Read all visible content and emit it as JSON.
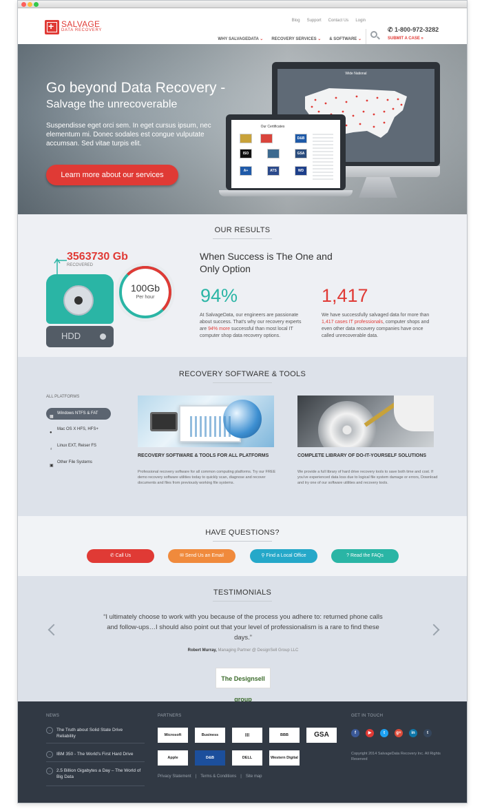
{
  "header": {
    "logo_line1": "SALVAGE",
    "logo_line2": "DATA RECOVERY",
    "toplinks": [
      "Blog",
      "Support",
      "Contact Us",
      "Login"
    ],
    "nav": [
      "WHY SALVAGEDATA",
      "RECOVERY SERVICES",
      "& SOFTWARE"
    ],
    "phone": "1-800-972-3282",
    "submit": "SUBMIT A CASE »"
  },
  "hero": {
    "title": "Go beyond Data Recovery -",
    "subtitle": "Salvage the unrecoverable",
    "text": "Suspendisse eget orci sem. In eget cursus ipsum, nec elementum mi. Donec sodales est congue vulputate accumsan. Sed vitae turpis elit.",
    "cta": "Learn more about our services",
    "monitor_title": "Wide National",
    "laptop_title": "Our Certificates",
    "certs": [
      "ISO",
      "GSA",
      "D&B",
      "A+",
      "ATS",
      "WD"
    ]
  },
  "results": {
    "title": "OUR RESULTS",
    "recovered_value": "3563730 Gb",
    "recovered_label": "RECOVERED",
    "hdd_label": "HDD",
    "gauge_value": "100Gb",
    "gauge_unit": "Per hour",
    "heading": "When Success is The One and Only Option",
    "stat1": "94%",
    "stat1_text_a": "At SalvageData, our engineers are passionate about success. That's why our recovery experts are ",
    "stat1_em": "94% more",
    "stat1_text_b": " successful than most local IT computer shop data recovery options.",
    "stat2": "1,417",
    "stat2_text_a": "We have successfully salvaged data for more than ",
    "stat2_em": "1,417 cases IT professionals",
    "stat2_text_b": ", computer shops and even other data recovery companies have once called unrecoverable data."
  },
  "recovery": {
    "title": "RECOVERY SOFTWARE & TOOLS",
    "platforms_heading": "ALL PLATFORMS",
    "platforms": [
      "Windows NTFS & FAT",
      "Mac OS X HFS, HFS+",
      "Linux EXT, Reiser FS",
      "Other File Systems"
    ],
    "card1_title": "RECOVERY SOFTWARE & TOOLS FOR ALL PLATFORMS",
    "card1_text": "Professional recovery software for all common computing platforms. Try our FREE demo recovery software utilities today to quickly scan, diagnose and recover documents and files from previously working file systems.",
    "card2_title": "COMPLETE LIBRARY OF DO-IT-YOURSELF SOLUTIONS",
    "card2_text": "We provide a full library of hard drive recovery tools to save both time and cost. If you've experienced data loss due to logical file system damage or errors, Download and try one of our software utilities and recovery tools."
  },
  "questions": {
    "title": "HAVE QUESTIONS?",
    "buttons": [
      "Call Us",
      "Send Us an Email",
      "Find a Local Office",
      "Read the FAQs"
    ]
  },
  "testimonials": {
    "title": "TESTIMONIALS",
    "quote": "“I ultimately choose to work with you because of the process you adhere to: returned phone calls and follow-ups…I should also point out that your level of professionalism is a rare to find these days.”",
    "author": "Robert Murray,",
    "role": "Managing Partner @ DesignSell Group LLC",
    "logo_text": "The Designsell group"
  },
  "footer": {
    "news_heading": "NEWS",
    "news": [
      "The Truth about Solid State Drive Reliability",
      "IBM 350 - The World's First Hard Drive",
      "2.5 Billion Gigabytes a Day – The World of Big Data"
    ],
    "partners_heading": "PARTNERS",
    "partners": [
      "Microsoft",
      "Business Partner",
      "||||",
      "BBB",
      "GSA",
      "Apple",
      "D&B",
      "DELL",
      "Western Digital"
    ],
    "links": [
      "Privacy Statement",
      "Terms & Conditions",
      "Site map"
    ],
    "contact_heading": "GET IN TOUCH",
    "social": [
      "f",
      "▶",
      "t",
      "g+",
      "in",
      "t"
    ],
    "copyright": "Copyright 2014 SalvageData Recovery Inc. All Rights Reserved"
  }
}
